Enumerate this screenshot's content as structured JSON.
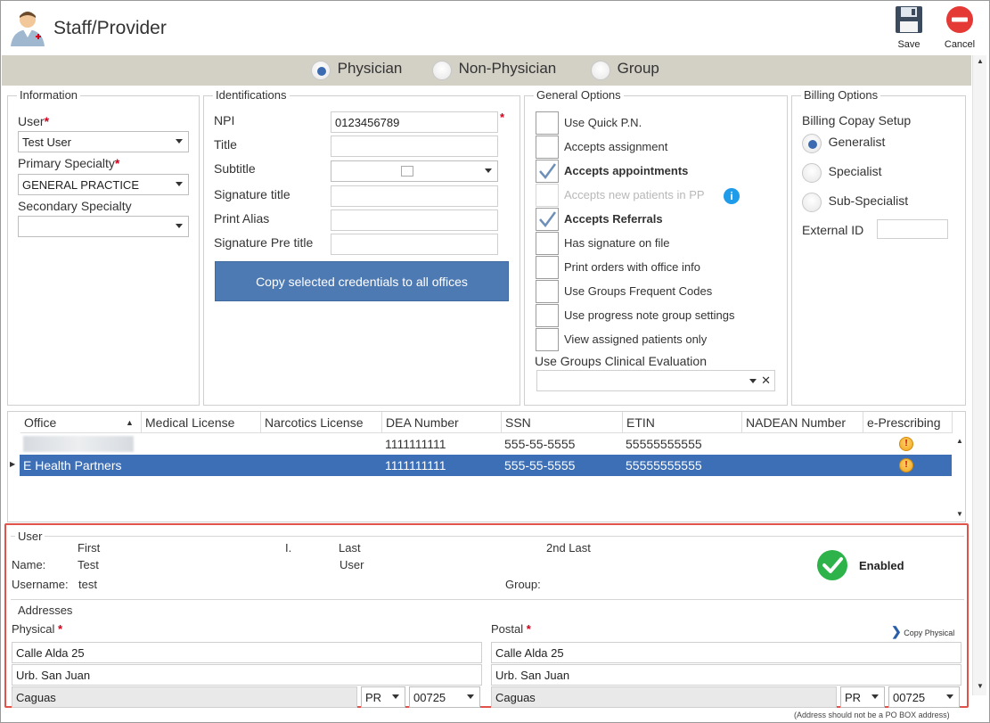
{
  "window": {
    "title": "Staff/Provider"
  },
  "toolbar": {
    "save_label": "Save",
    "cancel_label": "Cancel"
  },
  "provider_type": {
    "options": [
      {
        "label": "Physician",
        "selected": true
      },
      {
        "label": "Non-Physician",
        "selected": false
      },
      {
        "label": "Group",
        "selected": false
      }
    ]
  },
  "information": {
    "title": "Information",
    "user_label": "User",
    "user_value": "Test User",
    "primary_specialty_label": "Primary Specialty",
    "primary_specialty_value": "GENERAL PRACTICE",
    "secondary_specialty_label": "Secondary Specialty",
    "secondary_specialty_value": ""
  },
  "identifications": {
    "title": "Identifications",
    "npi_label": "NPI",
    "npi_value": "0123456789",
    "title_label": "Title",
    "subtitle_label": "Subtitle",
    "signature_title_label": "Signature title",
    "print_alias_label": "Print Alias",
    "signature_pre_title_label": "Signature Pre title",
    "copy_button_label": "Copy selected credentials to all offices"
  },
  "general_options": {
    "title": "General Options",
    "items": [
      {
        "label": "Use Quick P.N.",
        "checked": false,
        "bold": false,
        "disabled": false
      },
      {
        "label": "Accepts assignment",
        "checked": false,
        "bold": false,
        "disabled": false
      },
      {
        "label": "Accepts appointments",
        "checked": true,
        "bold": true,
        "disabled": false
      },
      {
        "label": "Accepts new patients in PP",
        "checked": false,
        "bold": false,
        "disabled": true
      },
      {
        "label": "Accepts Referrals",
        "checked": true,
        "bold": true,
        "disabled": false
      },
      {
        "label": "Has signature on file",
        "checked": false,
        "bold": false,
        "disabled": false
      },
      {
        "label": "Print orders with office info",
        "checked": false,
        "bold": false,
        "disabled": false
      },
      {
        "label": "Use Groups Frequent Codes",
        "checked": false,
        "bold": false,
        "disabled": false
      },
      {
        "label": "Use progress note group settings",
        "checked": false,
        "bold": false,
        "disabled": false
      },
      {
        "label": "View assigned patients only",
        "checked": false,
        "bold": false,
        "disabled": false
      }
    ],
    "clinical_eval_label": "Use Groups Clinical Evaluation",
    "clinical_eval_value": ""
  },
  "billing_options": {
    "title": "Billing Options",
    "copay_label": "Billing Copay Setup",
    "copay_options": [
      {
        "label": "Generalist",
        "selected": true
      },
      {
        "label": "Specialist",
        "selected": false
      },
      {
        "label": "Sub-Specialist",
        "selected": false
      }
    ],
    "external_id_label": "External ID",
    "external_id_value": ""
  },
  "offices_grid": {
    "columns": [
      "Office",
      "Medical License",
      "Narcotics License",
      "DEA Number",
      "SSN",
      "ETIN",
      "NADEAN Number",
      "e-Prescribing"
    ],
    "rows": [
      {
        "office": "",
        "medical_license": "",
        "narcotics_license": "",
        "dea": "1111111111",
        "ssn": "555-55-5555",
        "etin": "55555555555",
        "nadean": "",
        "selected": false
      },
      {
        "office": "E Health Partners",
        "medical_license": "",
        "narcotics_license": "",
        "dea": "1111111111",
        "ssn": "555-55-5555",
        "etin": "55555555555",
        "nadean": "",
        "selected": true
      }
    ]
  },
  "user_section": {
    "title": "User",
    "first_header": "First",
    "initial_header": "I.",
    "last_header": "Last",
    "second_last_header": "2nd Last",
    "name_label": "Name:",
    "first_value": "Test",
    "last_value": "User",
    "username_label": "Username:",
    "username_value": "test",
    "group_label": "Group:",
    "group_value": "",
    "status_label": "Enabled"
  },
  "addresses": {
    "title": "Addresses",
    "physical_label": "Physical",
    "postal_label": "Postal",
    "copy_physical_label": "Copy Physical",
    "physical": {
      "line1": "Calle Alda 25",
      "line2": "Urb. San Juan",
      "city": "Caguas",
      "state": "PR",
      "zip": "00725"
    },
    "postal": {
      "line1": "Calle Alda 25",
      "line2": "Urb. San Juan",
      "city": "Caguas",
      "state": "PR",
      "zip": "00725"
    },
    "note": "(Address should not be a PO BOX address)"
  },
  "colors": {
    "accent": "#4e7ab3",
    "selected_row": "#3d6fb6",
    "highlight_border": "#e0524a",
    "enabled_green": "#2db34a",
    "required": "#d0021b"
  }
}
